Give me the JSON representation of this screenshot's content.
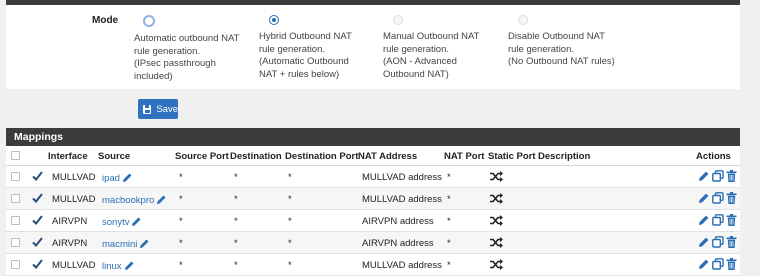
{
  "mode": {
    "label": "Mode",
    "options": [
      {
        "text": "Automatic outbound NAT\nrule generation.\n(IPsec passthrough\nincluded)",
        "state": "focused"
      },
      {
        "text": "Hybrid Outbound NAT\nrule generation.\n(Automatic Outbound\nNAT + rules below)",
        "state": "checked"
      },
      {
        "text": "Manual Outbound NAT\nrule generation.\n(AON - Advanced\nOutbound NAT)",
        "state": "disabled"
      },
      {
        "text": "Disable Outbound NAT\nrule generation.\n(No Outbound NAT rules)",
        "state": "disabled"
      }
    ]
  },
  "save_button": {
    "label": "Save",
    "icon": "floppy-disk-icon"
  },
  "mappings": {
    "title": "Mappings",
    "columns": {
      "interface": "Interface",
      "source": "Source",
      "source_port": "Source Port",
      "destination": "Destination",
      "destination_port": "Destination Port",
      "nat_address": "NAT Address",
      "nat_port": "NAT Port",
      "static_port": "Static Port",
      "description": "Description",
      "actions": "Actions"
    },
    "rows": [
      {
        "interface": "MULLVAD",
        "source": "ipad",
        "source_port": "*",
        "destination": "*",
        "destination_port": "*",
        "nat_address": "MULLVAD address",
        "nat_port": "*",
        "description": ""
      },
      {
        "interface": "MULLVAD",
        "source": "macbookpro",
        "source_port": "*",
        "destination": "*",
        "destination_port": "*",
        "nat_address": "MULLVAD address",
        "nat_port": "*",
        "description": ""
      },
      {
        "interface": "AIRVPN",
        "source": "sonytv",
        "source_port": "*",
        "destination": "*",
        "destination_port": "*",
        "nat_address": "AIRVPN address",
        "nat_port": "*",
        "description": ""
      },
      {
        "interface": "AIRVPN",
        "source": "macmini",
        "source_port": "*",
        "destination": "*",
        "destination_port": "*",
        "nat_address": "AIRVPN address",
        "nat_port": "*",
        "description": ""
      },
      {
        "interface": "MULLVAD",
        "source": "linux",
        "source_port": "*",
        "destination": "*",
        "destination_port": "*",
        "nat_address": "MULLVAD address",
        "nat_port": "*",
        "description": ""
      }
    ]
  },
  "colors": {
    "header_bg": "#3c3c3c",
    "accent": "#2a6fb3",
    "button": "#2f73c0"
  }
}
